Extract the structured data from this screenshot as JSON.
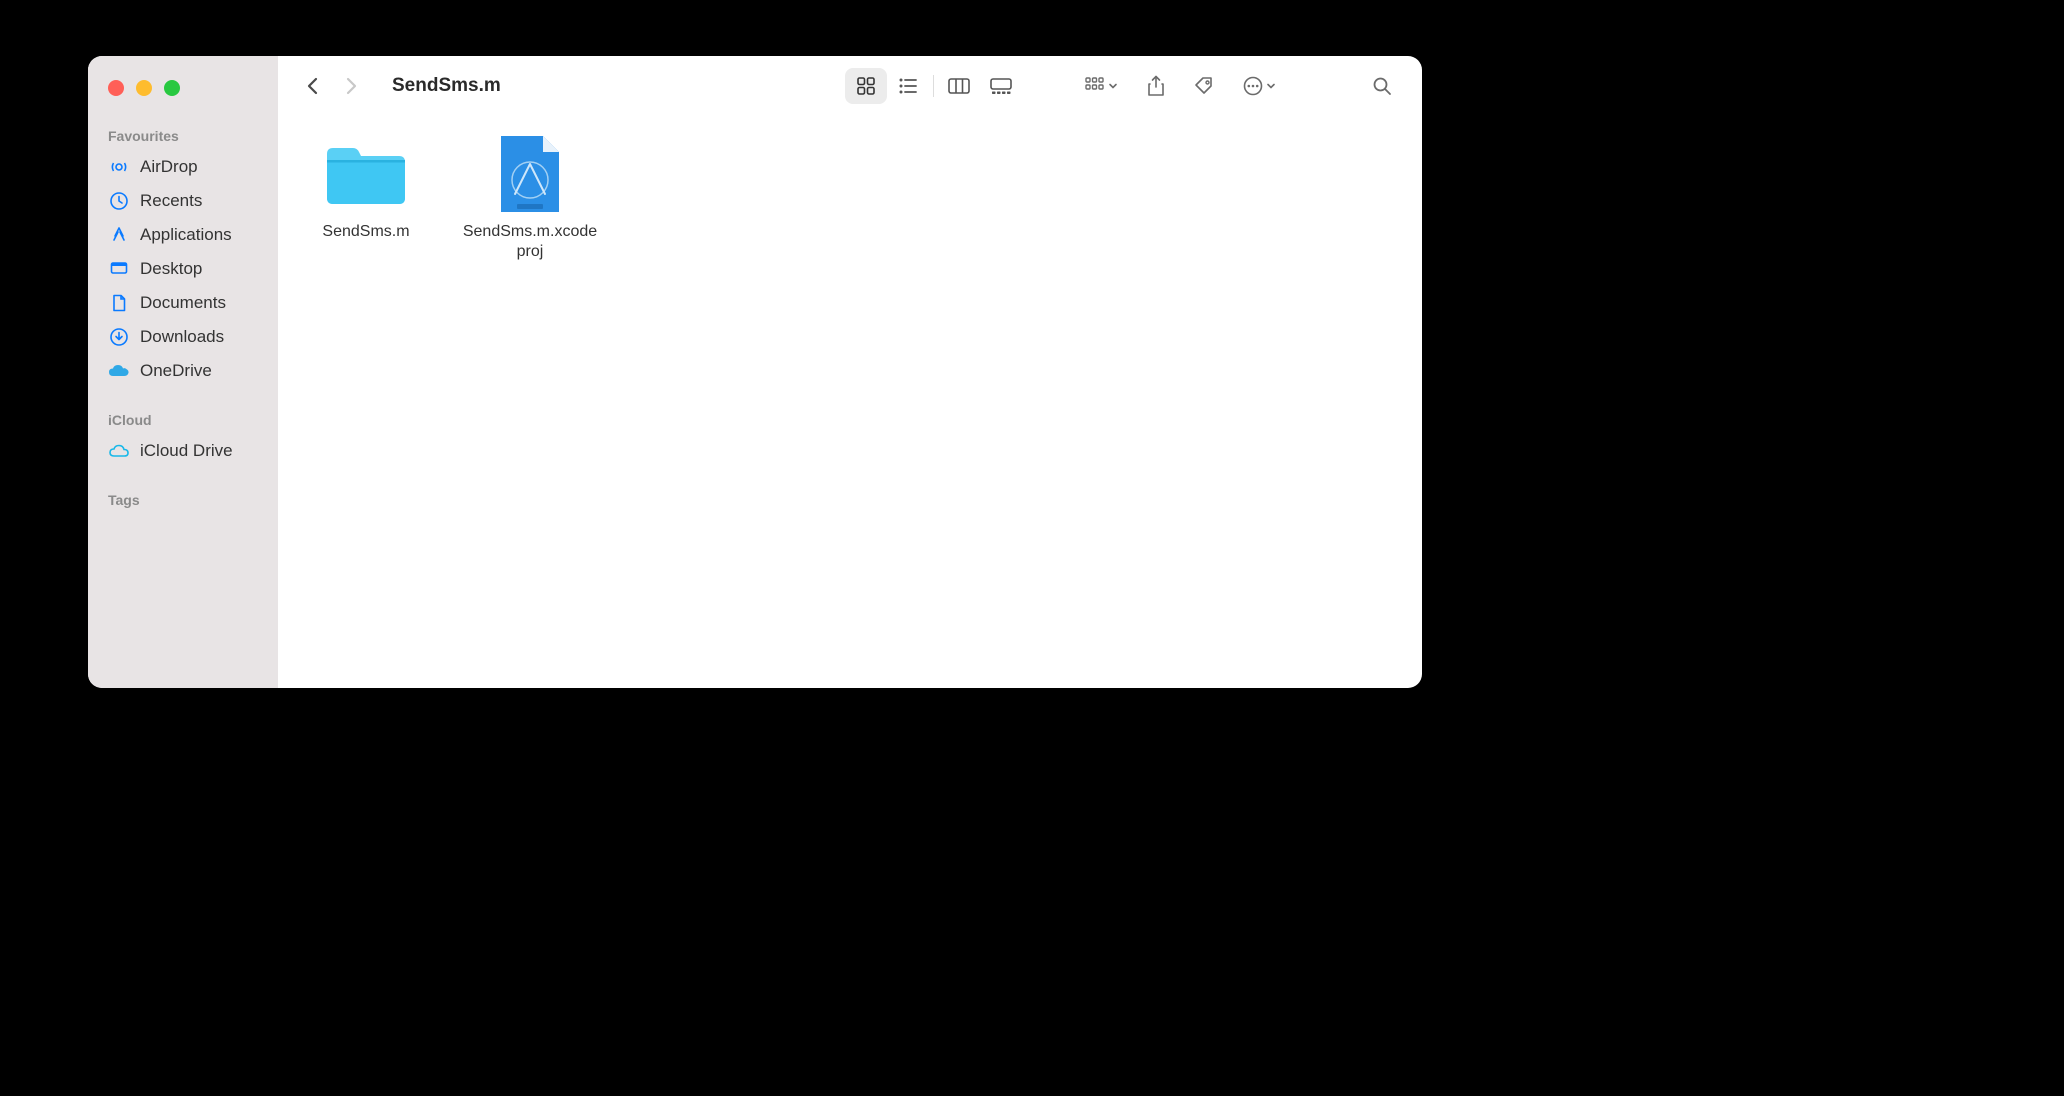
{
  "window": {
    "title": "SendSms.m"
  },
  "sidebar": {
    "sections": [
      {
        "header": "Favourites",
        "items": [
          {
            "icon": "airdrop",
            "label": "AirDrop"
          },
          {
            "icon": "clock",
            "label": "Recents"
          },
          {
            "icon": "app",
            "label": "Applications"
          },
          {
            "icon": "desktop",
            "label": "Desktop"
          },
          {
            "icon": "document",
            "label": "Documents"
          },
          {
            "icon": "download",
            "label": "Downloads"
          },
          {
            "icon": "onedrive",
            "label": "OneDrive"
          }
        ]
      },
      {
        "header": "iCloud",
        "items": [
          {
            "icon": "cloud",
            "label": "iCloud Drive"
          }
        ]
      },
      {
        "header": "Tags",
        "items": []
      }
    ]
  },
  "toolbar": {
    "view_mode": "icon"
  },
  "files": [
    {
      "type": "folder",
      "name": "SendSms.m"
    },
    {
      "type": "xcodeproj",
      "name": "SendSms.m.xcodeproj"
    }
  ],
  "colors": {
    "accent": "#0a7aff",
    "folder": "#3fc7f3",
    "xcode": "#2b8fe6"
  }
}
